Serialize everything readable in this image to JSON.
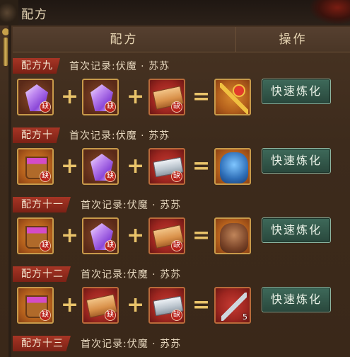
{
  "window": {
    "title": "配方"
  },
  "table": {
    "col_recipe": "配方",
    "col_action": "操作"
  },
  "missing_badge": "缺",
  "recipes": [
    {
      "label": "配方九",
      "record": "首次记录:伏魔 · 苏苏",
      "button": "快速炼化",
      "result_count": ""
    },
    {
      "label": "配方十",
      "record": "首次记录:伏魔 · 苏苏",
      "button": "快速炼化",
      "result_count": ""
    },
    {
      "label": "配方十一",
      "record": "首次记录:伏魔 · 苏苏",
      "button": "快速炼化",
      "result_count": ""
    },
    {
      "label": "配方十二",
      "record": "首次记录:伏魔 · 苏苏",
      "button": "快速炼化",
      "result_count": "5"
    },
    {
      "label": "配方十三",
      "record": "首次记录:伏魔 · 苏苏",
      "button": "",
      "result_count": ""
    }
  ],
  "symbols": {
    "plus": "+",
    "equals": "="
  }
}
